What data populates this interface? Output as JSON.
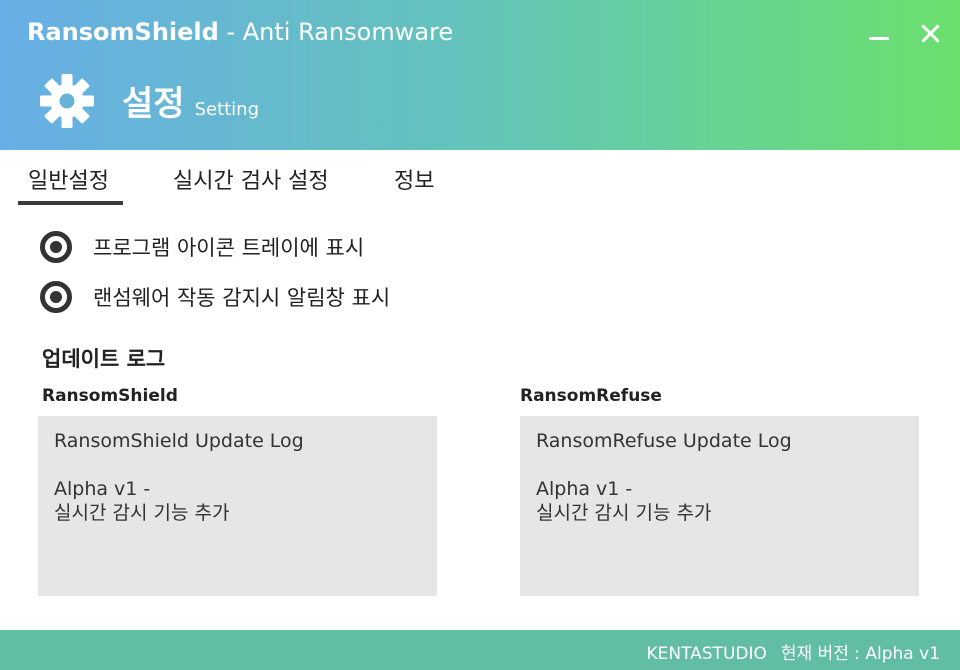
{
  "window": {
    "title_bold": "RansomShield",
    "title_light": "- Anti Ransomware",
    "minimize_icon": "minimize-icon",
    "close_icon": "close-icon"
  },
  "header": {
    "icon": "gear-icon",
    "title": "설정",
    "subtitle": "Setting"
  },
  "tabs": [
    {
      "label": "일반설정",
      "active": true
    },
    {
      "label": "실시간 검사 설정",
      "active": false
    },
    {
      "label": "정보",
      "active": false
    }
  ],
  "options": [
    {
      "label": "프로그램 아이콘 트레이에 표시",
      "selected": true
    },
    {
      "label": "랜섬웨어 작동 감지시 알림창 표시",
      "selected": true
    }
  ],
  "update_log": {
    "title": "업데이트 로그",
    "logs": [
      {
        "label": "RansomShield",
        "heading": "RansomShield Update Log",
        "version": "Alpha v1 -",
        "detail": "실시간 감시 기능 추가"
      },
      {
        "label": "RansomRefuse",
        "heading": "RansomRefuse Update Log",
        "version": "Alpha v1 -",
        "detail": "실시간 감시 기능 추가"
      }
    ]
  },
  "footer": {
    "company": "KENTASTUDIO",
    "version": "현재 버전 : Alpha v1"
  },
  "colors": {
    "header_gradient_start": "#67aee6",
    "header_gradient_end": "#6be06d",
    "footer": "#62bda5",
    "log_box": "#e6e6e6"
  }
}
